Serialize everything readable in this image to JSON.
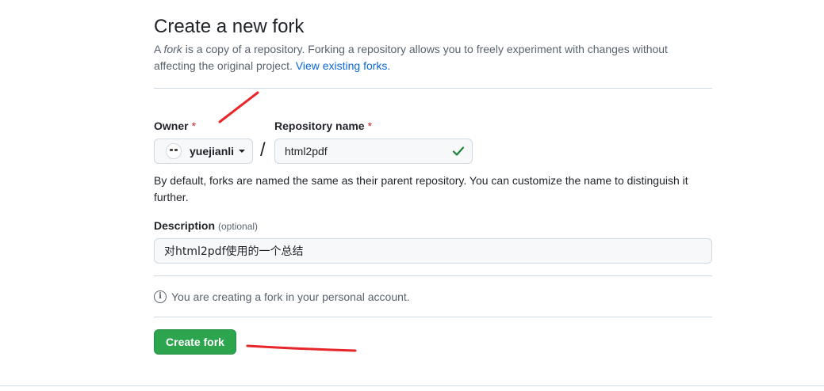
{
  "page": {
    "title": "Create a new fork",
    "intro_prefix": "A ",
    "intro_em": "fork",
    "intro_rest": " is a copy of a repository. Forking a repository allows you to freely experiment with changes without affecting the original project. ",
    "intro_link": "View existing forks."
  },
  "form": {
    "owner_label": "Owner",
    "repo_label": "Repository name",
    "required_mark": "*",
    "owner_value": "yuejianli",
    "slash": "/",
    "repo_value": "html2pdf",
    "repo_help": "By default, forks are named the same as their parent repository. You can customize the name to distinguish it further.",
    "description_label": "Description",
    "description_optional": "(optional)",
    "description_value": "对html2pdf使用的一个总结",
    "info_text": "You are creating a fork in your personal account.",
    "create_button": "Create fork"
  },
  "icons": {
    "owner_avatar": "avatar-icon",
    "owner_caret": "caret-down-icon",
    "repo_valid": "check-icon",
    "info": "info-icon"
  },
  "colors": {
    "primary_button": "#2da44e",
    "link": "#0969da",
    "required": "#d1242f",
    "valid_check": "#1a7f37",
    "annotation": "#e8262a"
  }
}
